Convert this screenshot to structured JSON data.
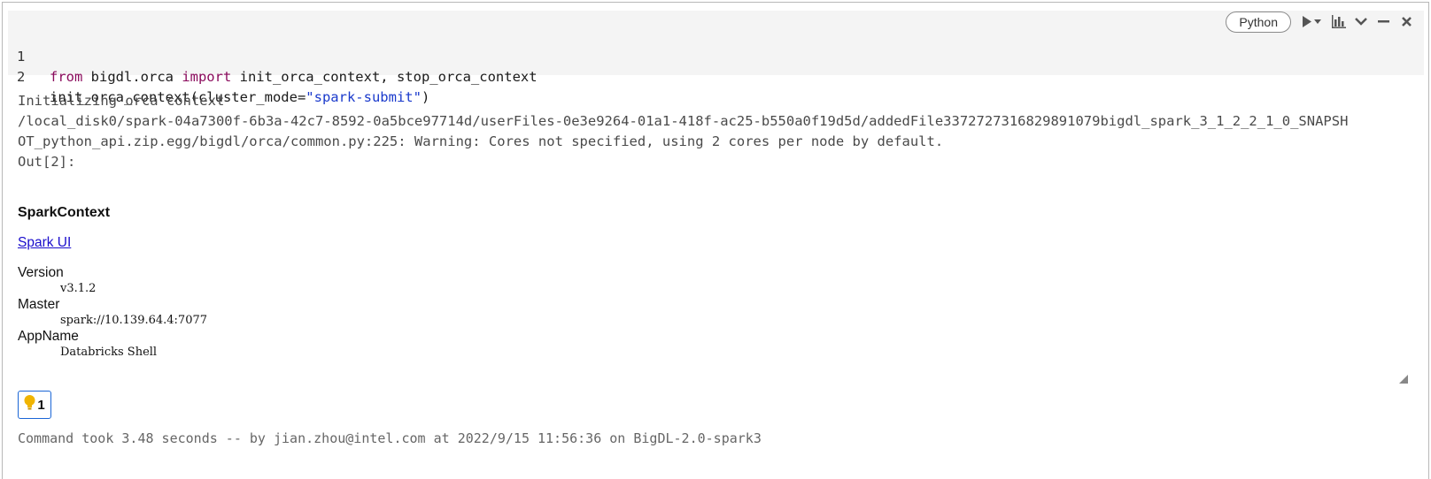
{
  "cell": {
    "language": "Python",
    "code_lines": [
      {
        "number": "1",
        "tokens": [
          {
            "text": "from",
            "kind": "keyword"
          },
          {
            "text": " bigdl.orca ",
            "kind": "plain"
          },
          {
            "text": "import",
            "kind": "keyword"
          },
          {
            "text": " init_orca_context, stop_orca_context",
            "kind": "plain"
          }
        ]
      },
      {
        "number": "2",
        "tokens": [
          {
            "text": "init_orca_context(cluster_mode=",
            "kind": "plain"
          },
          {
            "text": "\"spark-submit\"",
            "kind": "string"
          },
          {
            "text": ")",
            "kind": "plain"
          }
        ]
      }
    ]
  },
  "toolbar": {
    "icons": [
      "run-icon",
      "run-menu-caret-icon",
      "chart-icon",
      "collapse-chevron-icon",
      "minimize-icon",
      "close-icon"
    ]
  },
  "output": {
    "stdout_lines": [
      "Initializing orca context",
      "/local_disk0/spark-04a7300f-6b3a-42c7-8592-0a5bce97714d/userFiles-0e3e9264-01a1-418f-ac25-b550a0f19d5d/addedFile3372727316829891079bigdl_spark_3_1_2_2_1_0_SNAPSH",
      "OT_python_api.zip.egg/bigdl/orca/common.py:225: Warning: Cores not specified, using 2 cores per node by default.",
      "Out[2]:"
    ],
    "spark_context": {
      "title": "SparkContext",
      "link_label": "Spark UI",
      "fields": [
        {
          "label": "Version",
          "value": "v3.1.2"
        },
        {
          "label": "Master",
          "value": "spark://10.139.64.4:7077"
        },
        {
          "label": "AppName",
          "value": "Databricks Shell"
        }
      ]
    }
  },
  "advice": {
    "count": "1",
    "icon": "lightbulb-icon",
    "icon_color": "#f0b400",
    "border_color": "#1a66d6"
  },
  "footer": {
    "text": "Command took 3.48 seconds -- by jian.zhou@intel.com at 2022/9/15 11:56:36 on BigDL-2.0-spark3"
  },
  "colors": {
    "keyword": "#8a0a5c",
    "string": "#1a3acc",
    "code_background": "#f4f4f4",
    "link": "#1a0dcc"
  }
}
